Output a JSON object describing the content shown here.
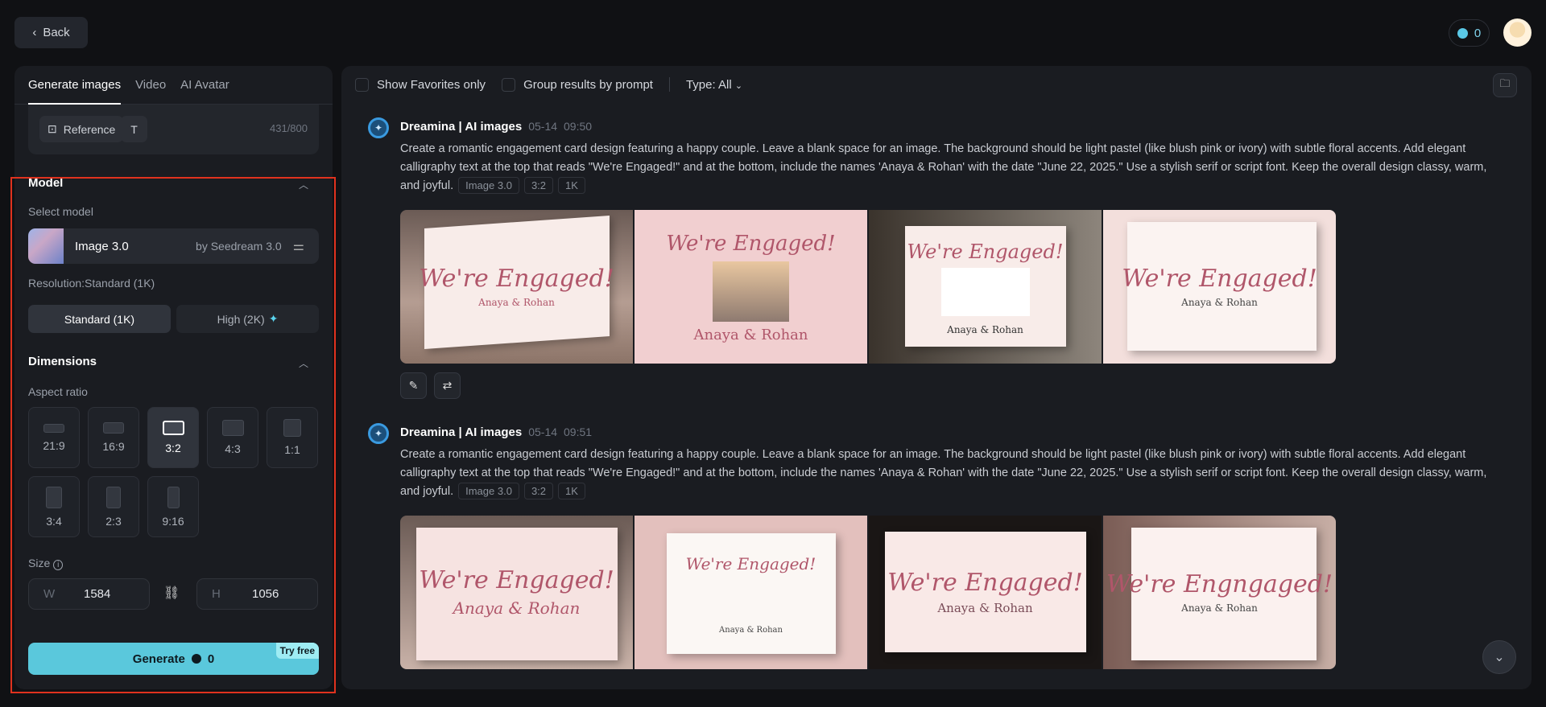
{
  "header": {
    "back_label": "Back",
    "credits": "0"
  },
  "left": {
    "tabs": [
      "Generate images",
      "Video",
      "AI Avatar"
    ],
    "reference_label": "Reference",
    "char_count": "431/800",
    "model_section": "Model",
    "select_model_label": "Select model",
    "model_name": "Image 3.0",
    "model_provider": "by Seedream 3.0",
    "resolution_label": "Resolution:Standard (1K)",
    "res_standard": "Standard (1K)",
    "res_high": "High (2K)",
    "dimensions_section": "Dimensions",
    "aspect_label": "Aspect ratio",
    "aspects": [
      "21:9",
      "16:9",
      "3:2",
      "4:3",
      "1:1",
      "3:4",
      "2:3",
      "9:16"
    ],
    "selected_aspect": "3:2",
    "size_label": "Size",
    "width_key": "W",
    "width": "1584",
    "height_key": "H",
    "height": "1056",
    "generate_label": "Generate",
    "generate_cost": "0",
    "try_free": "Try free"
  },
  "main": {
    "show_favorites": "Show Favorites only",
    "group_results": "Group results by prompt",
    "type_filter": "Type: All",
    "entries": [
      {
        "author": "Dreamina | AI images",
        "date": "05-14",
        "time": "09:50",
        "prompt": "Create a romantic engagement card design featuring a happy couple. Leave a blank space for an image. The background should be light pastel (like blush pink or ivory) with subtle floral accents. Add elegant calligraphy text at the top that reads \"We're Engaged!\" and at the bottom, include the names 'Anaya & Rohan' with the date \"June 22, 2025.\" Use a stylish serif or script font. Keep the overall design classy, warm, and joyful.",
        "tags": [
          "Image 3.0",
          "3:2",
          "1K"
        ],
        "images": [
          {
            "title": "We're Engaged!",
            "names": "Anaya & Rohan"
          },
          {
            "title": "We're Engaged!",
            "names": "Anaya & Rohan"
          },
          {
            "title": "We're Engaged!",
            "names": "Anaya & Rohan"
          },
          {
            "title": "We're Engaged!",
            "names": "Anaya & Rohan"
          }
        ]
      },
      {
        "author": "Dreamina | AI images",
        "date": "05-14",
        "time": "09:51",
        "prompt": "Create a romantic engagement card design featuring a happy couple. Leave a blank space for an image. The background should be light pastel (like blush pink or ivory) with subtle floral accents. Add elegant calligraphy text at the top that reads \"We're Engaged!\" and at the bottom, include the names 'Anaya & Rohan' with the date \"June 22, 2025.\" Use a stylish serif or script font. Keep the overall design classy, warm, and joyful.",
        "tags": [
          "Image 3.0",
          "3:2",
          "1K"
        ],
        "images": [
          {
            "title": "We're Engaged!",
            "names": "Anaya & Rohan"
          },
          {
            "title": "We're Engaged!",
            "names": "Anaya & Rohan"
          },
          {
            "title": "We're Engaged!",
            "names": "Anaya & Rohan"
          },
          {
            "title": "We're Engngaged!",
            "names": "Anaya & Rohan"
          }
        ]
      }
    ]
  },
  "colors": {
    "accent": "#5ac8dc",
    "annotation": "#e0321e"
  }
}
